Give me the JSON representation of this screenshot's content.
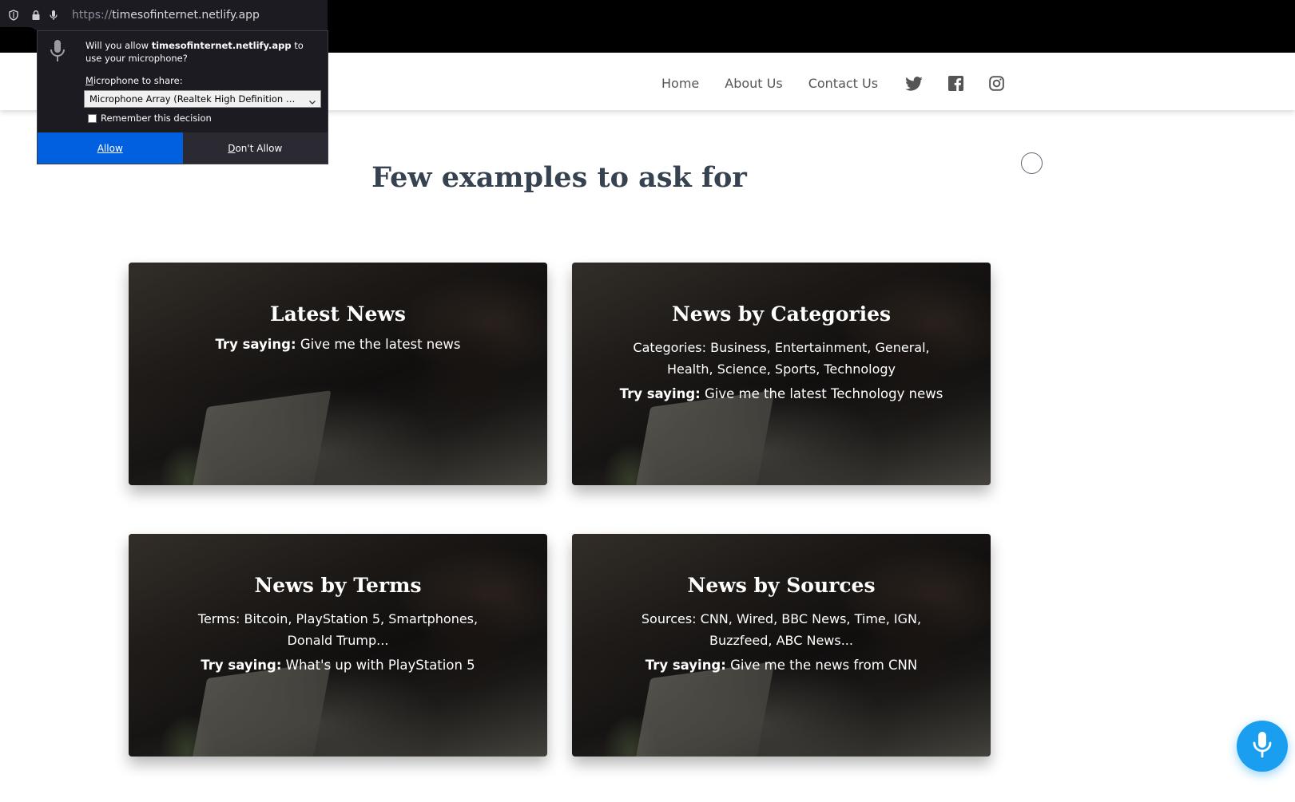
{
  "browser": {
    "url_protocol": "https://",
    "url_host": "timesofinternet.netlify.app",
    "icons": [
      "shield-icon",
      "lock-icon",
      "microphone-icon"
    ]
  },
  "permission_popup": {
    "question_prefix": "Will you allow ",
    "question_host": "timesofinternet.netlify.app",
    "question_suffix": " to use your microphone?",
    "share_label_u": "M",
    "share_label_rest": "icrophone to share:",
    "selected_device": "Microphone Array (Realtek High Definition Audio)",
    "remember_label": "Remember this decision",
    "remember_checked": false,
    "allow_label": "Allow",
    "deny_label_u": "D",
    "deny_label_rest": "on't Allow",
    "allow_color": "#0060df"
  },
  "nav": {
    "links": [
      "Home",
      "About Us",
      "Contact Us"
    ],
    "social": [
      "twitter-icon",
      "facebook-icon",
      "instagram-icon"
    ]
  },
  "main": {
    "headline": "Few examples to ask for",
    "cards": [
      {
        "title": "Latest News",
        "desc": "",
        "try_label": "Try saying:",
        "try_text": " Give me the latest news"
      },
      {
        "title": "News by Categories",
        "desc": "Categories: Business, Entertainment, General, Health, Science, Sports, Technology",
        "try_label": "Try saying:",
        "try_text": " Give me the latest Technology news"
      },
      {
        "title": "News by Terms",
        "desc": "Terms: Bitcoin, PlayStation 5, Smartphones, Donald Trump...",
        "try_label": "Try saying:",
        "try_text": " What's up with PlayStation 5"
      },
      {
        "title": "News by Sources",
        "desc": "Sources: CNN, Wired, BBC News, Time, IGN, Buzzfeed, ABC News...",
        "try_label": "Try saying:",
        "try_text": " Give me the news from CNN"
      }
    ]
  },
  "colors": {
    "headline": "#364250",
    "fab": "#1a9ff0",
    "nav_text": "#555555"
  }
}
